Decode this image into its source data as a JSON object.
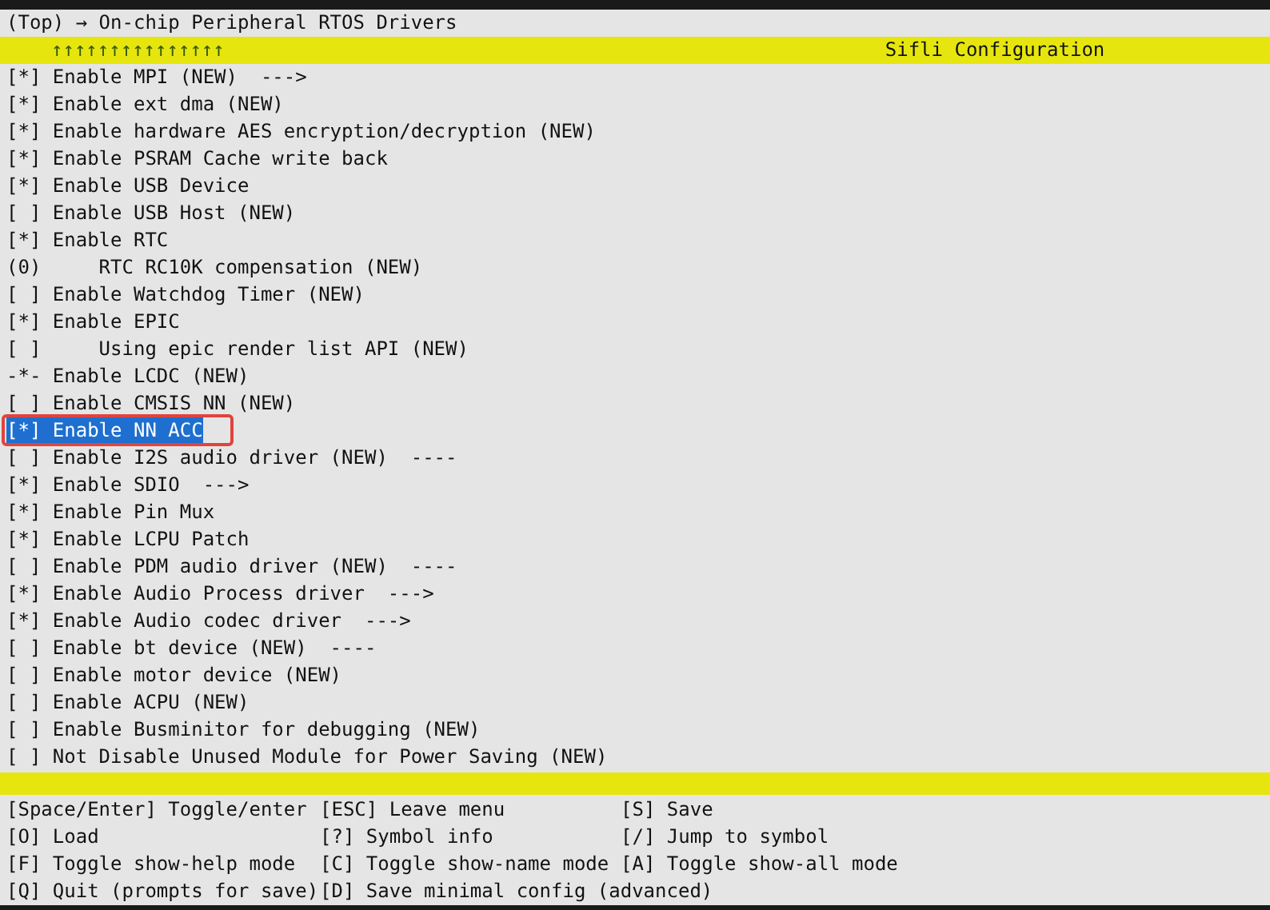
{
  "breadcrumb": "(Top) → On-chip Peripheral RTOS Drivers",
  "header": {
    "arrows": "↑↑↑↑↑↑↑↑↑↑↑↑↑↑↑",
    "title": "Sifli Configuration"
  },
  "items": [
    {
      "text": "[*] Enable MPI (NEW)  --->",
      "selected": false
    },
    {
      "text": "[*] Enable ext dma (NEW)",
      "selected": false
    },
    {
      "text": "[*] Enable hardware AES encryption/decryption (NEW)",
      "selected": false
    },
    {
      "text": "[*] Enable PSRAM Cache write back",
      "selected": false
    },
    {
      "text": "[*] Enable USB Device",
      "selected": false
    },
    {
      "text": "[ ] Enable USB Host (NEW)",
      "selected": false
    },
    {
      "text": "[*] Enable RTC",
      "selected": false
    },
    {
      "text": "(0)     RTC RC10K compensation (NEW)",
      "selected": false
    },
    {
      "text": "[ ] Enable Watchdog Timer (NEW)",
      "selected": false
    },
    {
      "text": "[*] Enable EPIC",
      "selected": false
    },
    {
      "text": "[ ]     Using epic render list API (NEW)",
      "selected": false
    },
    {
      "text": "-*- Enable LCDC (NEW)",
      "selected": false
    },
    {
      "text": "[ ] Enable CMSIS NN (NEW)",
      "selected": false
    },
    {
      "text": "[*] Enable NN ACC",
      "selected": true
    },
    {
      "text": "[ ] Enable I2S audio driver (NEW)  ----",
      "selected": false
    },
    {
      "text": "[*] Enable SDIO  --->",
      "selected": false
    },
    {
      "text": "[*] Enable Pin Mux",
      "selected": false
    },
    {
      "text": "[*] Enable LCPU Patch",
      "selected": false
    },
    {
      "text": "[ ] Enable PDM audio driver (NEW)  ----",
      "selected": false
    },
    {
      "text": "[*] Enable Audio Process driver  --->",
      "selected": false
    },
    {
      "text": "[*] Enable Audio codec driver  --->",
      "selected": false
    },
    {
      "text": "[ ] Enable bt device (NEW)  ----",
      "selected": false
    },
    {
      "text": "[ ] Enable motor device (NEW)",
      "selected": false
    },
    {
      "text": "[ ] Enable ACPU (NEW)",
      "selected": false
    },
    {
      "text": "[ ] Enable Busminitor for debugging (NEW)",
      "selected": false
    },
    {
      "text": "[ ] Not Disable Unused Module for Power Saving (NEW)",
      "selected": false
    }
  ],
  "help": [
    [
      "[Space/Enter] Toggle/enter",
      "[ESC] Leave menu",
      "[S] Save"
    ],
    [
      "[O] Load",
      "[?] Symbol info",
      "[/] Jump to symbol"
    ],
    [
      "[F] Toggle show-help mode",
      "[C] Toggle show-name mode",
      "[A] Toggle show-all mode"
    ],
    [
      "[Q] Quit (prompts for save)",
      "[D] Save minimal config (advanced)"
    ]
  ]
}
